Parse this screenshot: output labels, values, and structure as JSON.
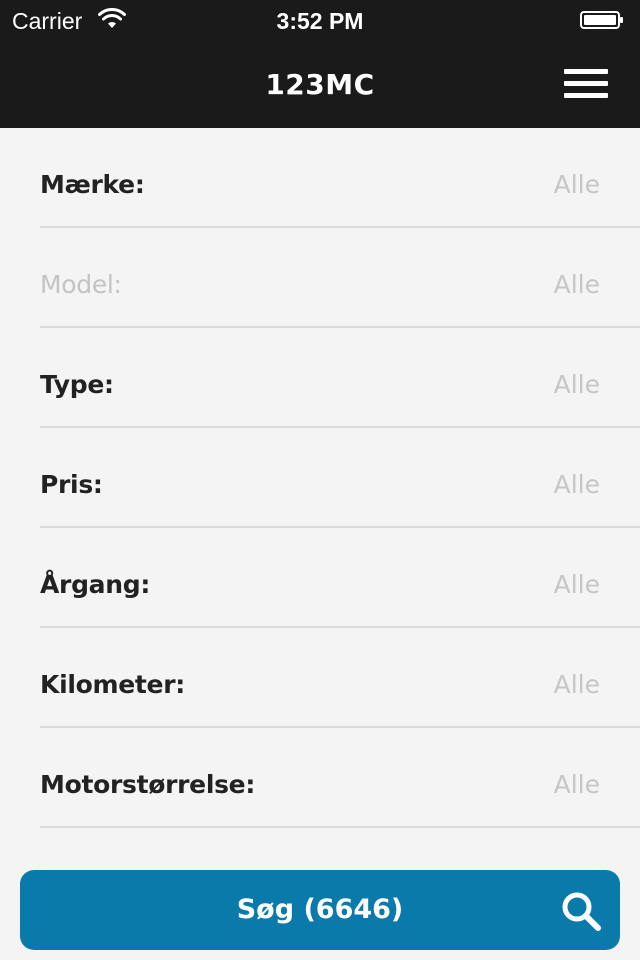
{
  "status_bar": {
    "carrier": "Carrier",
    "time": "3:52 PM",
    "wifi_icon": "wifi-icon",
    "battery_icon": "battery-icon"
  },
  "nav": {
    "title": "123MC",
    "menu_icon": "hamburger-menu-icon"
  },
  "filters": [
    {
      "label": "Mærke:",
      "value": "Alle",
      "enabled": true
    },
    {
      "label": "Model:",
      "value": "Alle",
      "enabled": false
    },
    {
      "label": "Type:",
      "value": "Alle",
      "enabled": true
    },
    {
      "label": "Pris:",
      "value": "Alle",
      "enabled": true
    },
    {
      "label": "Årgang:",
      "value": "Alle",
      "enabled": true
    },
    {
      "label": "Kilometer:",
      "value": "Alle",
      "enabled": true
    },
    {
      "label": "Motorstørrelse:",
      "value": "Alle",
      "enabled": true
    }
  ],
  "search_button": {
    "label": "Søg (6646)",
    "icon": "search-icon"
  },
  "colors": {
    "header_bg": "#1a1a1a",
    "page_bg": "#f4f4f4",
    "accent": "#0a7aaa",
    "label": "#222222",
    "muted": "#c6c6c6"
  }
}
